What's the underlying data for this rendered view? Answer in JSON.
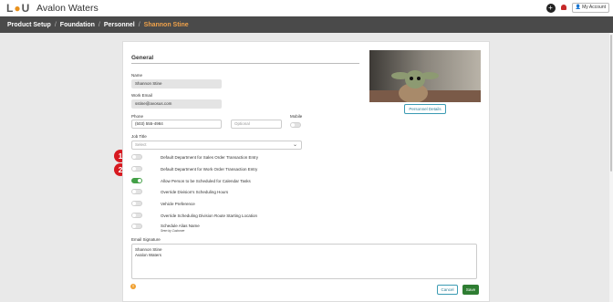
{
  "header": {
    "logo_text": "LOU",
    "company": "Avalon Waters",
    "account_label": "My Account"
  },
  "breadcrumb": [
    "Product Setup",
    "Foundation",
    "Personnel",
    "Shannon Stine"
  ],
  "section_title": "General",
  "form": {
    "name_label": "Name",
    "name_value": "Shannon Stine",
    "email_label": "Work Email",
    "email_value": "sstine@avosus.com",
    "phone_label": "Phone",
    "phone_value": "(503) 555-4984",
    "phone_ext_placeholder": "Optional",
    "mobile_label": "Mobile",
    "job_title_label": "Job Title",
    "job_title_placeholder": "Select"
  },
  "toggles": [
    {
      "label": "Default Department for Sales Order Transaction Entry",
      "on": false
    },
    {
      "label": "Default Department for Work Order Transaction Entry",
      "on": false
    },
    {
      "label": "Allow Person to be Scheduled for Calendar Tasks",
      "on": true
    },
    {
      "label": "Override Division's Scheduling Hours",
      "on": false
    },
    {
      "label": "Vehicle Preference",
      "on": false
    },
    {
      "label": "Override Scheduling Division Route Starting Location",
      "on": false
    },
    {
      "label": "Schedule Alias Name",
      "sublabel": "Seen by Customer",
      "on": false
    }
  ],
  "annotations": [
    "1",
    "2"
  ],
  "photo_button": "Personnel Details",
  "signature_label": "Email Signature",
  "signature_lines": [
    "Shannon Stine",
    "Avalon Waters"
  ],
  "buttons": {
    "cancel": "Cancel",
    "save": "Save"
  },
  "colors": {
    "accent": "#f0a24a",
    "crumb_bar": "#4a4a4a",
    "toggle_on": "#43a047",
    "save": "#2e7d32",
    "badge": "#d71920"
  }
}
